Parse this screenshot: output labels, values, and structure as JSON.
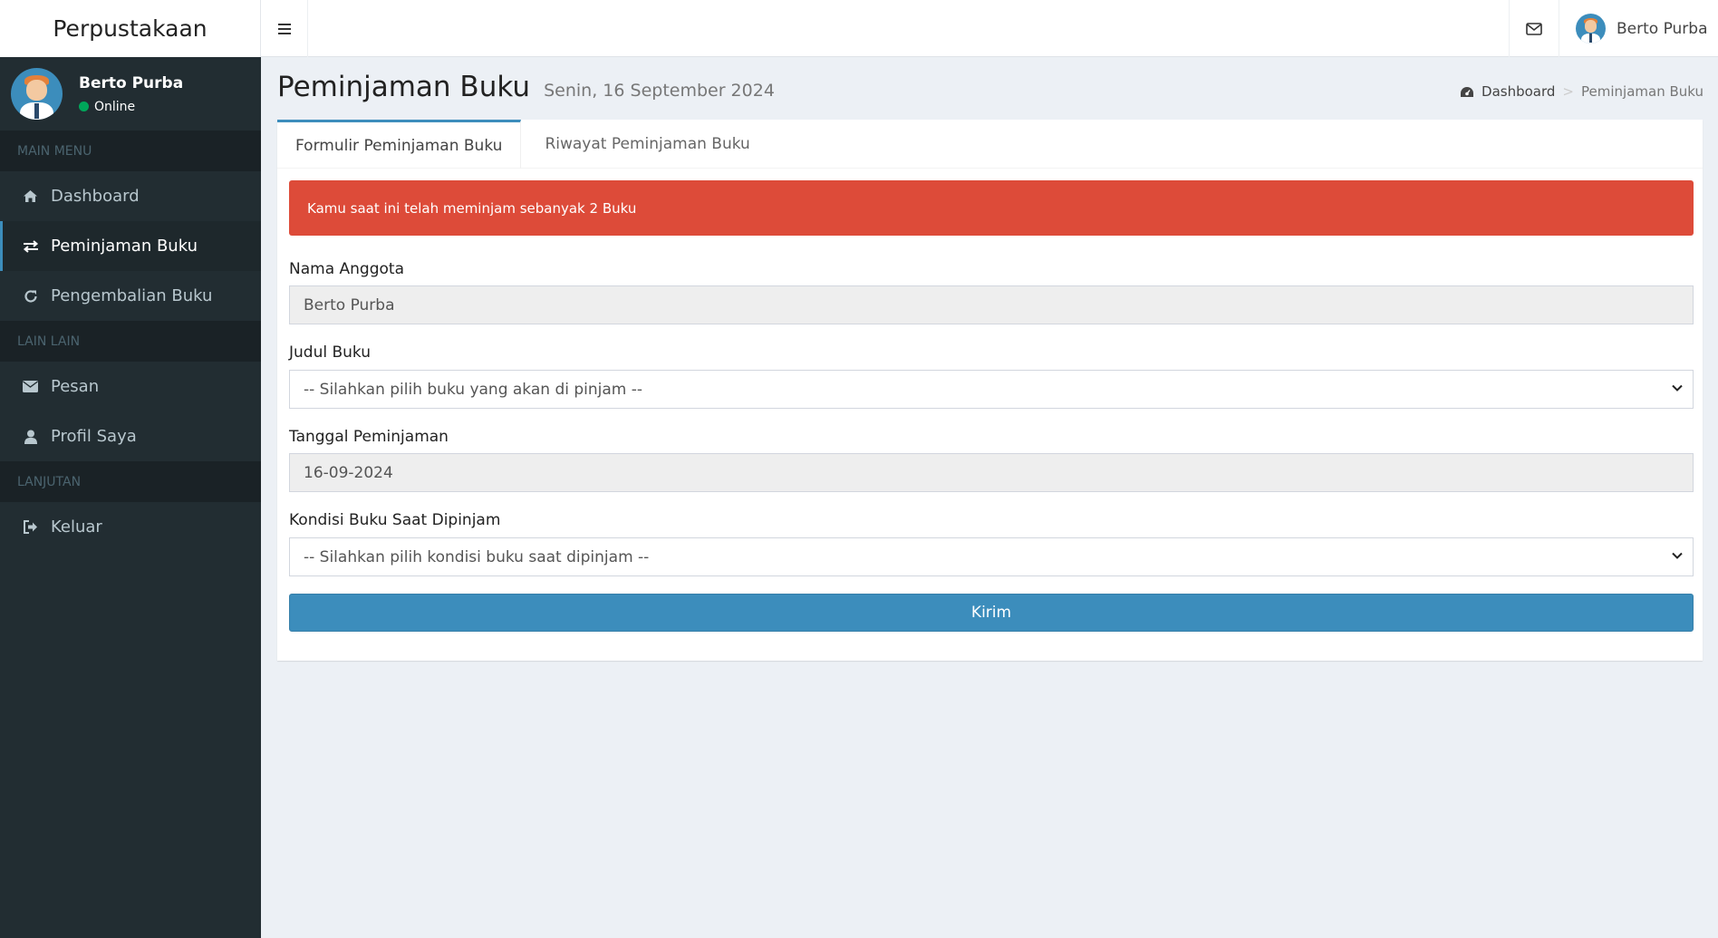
{
  "app": {
    "title": "Perpustakaan"
  },
  "navbar": {
    "menu_icon": "bars-icon",
    "mail_icon": "envelope-icon",
    "user_name": "Berto Purba"
  },
  "sidebar": {
    "user": {
      "name": "Berto Purba",
      "status": "Online",
      "status_color": "#00a65a"
    },
    "sections": [
      {
        "header": "MAIN MENU",
        "items": [
          {
            "label": "Dashboard",
            "icon": "home-icon",
            "active": false
          },
          {
            "label": "Peminjaman Buku",
            "icon": "exchange-icon",
            "active": true
          },
          {
            "label": "Pengembalian Buku",
            "icon": "refresh-icon",
            "active": false
          }
        ]
      },
      {
        "header": "LAIN LAIN",
        "items": [
          {
            "label": "Pesan",
            "icon": "envelope-icon",
            "active": false
          },
          {
            "label": "Profil Saya",
            "icon": "user-icon",
            "active": false
          }
        ]
      },
      {
        "header": "LANJUTAN",
        "items": [
          {
            "label": "Keluar",
            "icon": "sign-out-icon",
            "active": false
          }
        ]
      }
    ]
  },
  "content": {
    "title": "Peminjaman Buku",
    "subtitle": "Senin, 16 September 2024",
    "breadcrumb": {
      "home": "Dashboard",
      "current": "Peminjaman Buku",
      "separator": ">"
    },
    "tabs": [
      {
        "label": "Formulir Peminjaman Buku"
      },
      {
        "label": "Riwayat Peminjaman Buku"
      }
    ],
    "alert": "Kamu saat ini telah meminjam sebanyak 2 Buku",
    "form": {
      "nama_label": "Nama Anggota",
      "nama_value": "Berto Purba",
      "judul_label": "Judul Buku",
      "judul_value": "-- Silahkan pilih buku yang akan di pinjam --",
      "tanggal_label": "Tanggal Peminjaman",
      "tanggal_value": "16-09-2024",
      "kondisi_label": "Kondisi Buku Saat Dipinjam",
      "kondisi_value": "-- Silahkan pilih kondisi buku saat dipinjam --",
      "submit_label": "Kirim"
    }
  },
  "colors": {
    "sidebar": "#222d32",
    "accent": "#3c8dbc",
    "alert": "#dd4b39",
    "background": "#ecf0f5"
  }
}
